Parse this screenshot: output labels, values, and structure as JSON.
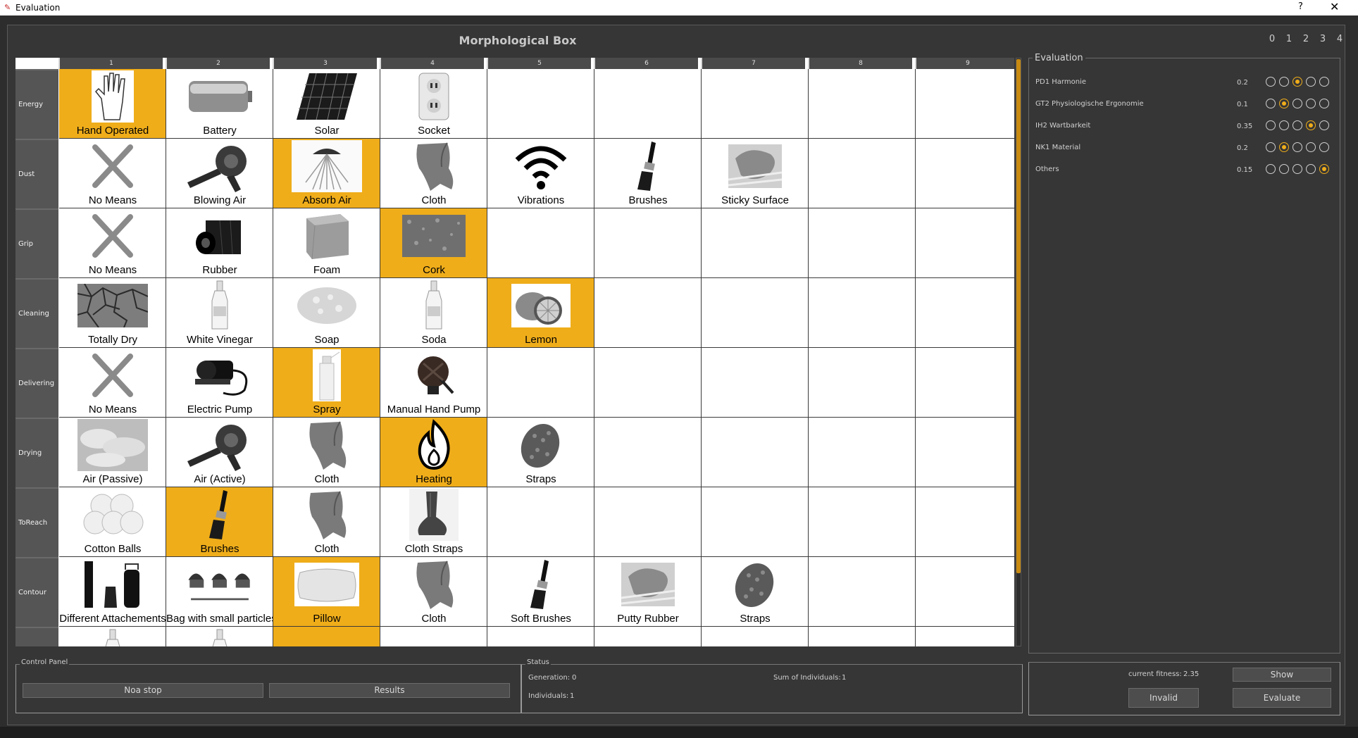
{
  "window": {
    "title": "Evaluation",
    "help": "?",
    "close": "✕"
  },
  "morph": {
    "title": "Morphological Box",
    "columns": [
      "1",
      "2",
      "3",
      "4",
      "5",
      "6",
      "7",
      "8",
      "9"
    ],
    "rows": [
      {
        "name": "Energy",
        "cells": [
          {
            "label": "Hand Operated",
            "icon": "hand",
            "sel": true
          },
          {
            "label": "Battery",
            "icon": "battery"
          },
          {
            "label": "Solar",
            "icon": "solar"
          },
          {
            "label": "Socket",
            "icon": "socket"
          },
          {},
          {},
          {},
          {},
          {}
        ]
      },
      {
        "name": "Dust",
        "cells": [
          {
            "label": "No Means",
            "icon": "x"
          },
          {
            "label": "Blowing   Air",
            "icon": "blower"
          },
          {
            "label": "Absorb    Air",
            "icon": "absorb",
            "sel": true
          },
          {
            "label": "Cloth",
            "icon": "cloth"
          },
          {
            "label": "Vibrations",
            "icon": "wifi"
          },
          {
            "label": "Brushes",
            "icon": "brush"
          },
          {
            "label": "Sticky Surface",
            "icon": "sticky"
          },
          {},
          {}
        ]
      },
      {
        "name": "Grip",
        "cells": [
          {
            "label": "No Means",
            "icon": "x"
          },
          {
            "label": "Rubber",
            "icon": "rubber"
          },
          {
            "label": "Foam",
            "icon": "foam"
          },
          {
            "label": "Cork",
            "icon": "cork",
            "sel": true
          },
          {},
          {},
          {},
          {},
          {}
        ]
      },
      {
        "name": "Cleaning",
        "cells": [
          {
            "label": "Totally    Dry",
            "icon": "dry"
          },
          {
            "label": "White Vinegar",
            "icon": "bottle"
          },
          {
            "label": "Soap",
            "icon": "soap"
          },
          {
            "label": "Soda",
            "icon": "bottle"
          },
          {
            "label": "Lemon",
            "icon": "lemon",
            "sel": true
          },
          {},
          {},
          {},
          {}
        ]
      },
      {
        "name": "Delivering",
        "cells": [
          {
            "label": "No Means",
            "icon": "x"
          },
          {
            "label": "Electric Pump",
            "icon": "pump"
          },
          {
            "label": "Spray",
            "icon": "spray",
            "sel": true
          },
          {
            "label": "Manual Hand Pump",
            "icon": "handpump"
          },
          {},
          {},
          {},
          {},
          {}
        ]
      },
      {
        "name": "Drying",
        "cells": [
          {
            "label": "Air  (Passive)",
            "icon": "clouds"
          },
          {
            "label": "Air     (Active)",
            "icon": "blower"
          },
          {
            "label": "Cloth",
            "icon": "cloth"
          },
          {
            "label": "Heating",
            "icon": "flame",
            "sel": true
          },
          {
            "label": "Straps",
            "icon": "straps"
          },
          {},
          {},
          {},
          {}
        ]
      },
      {
        "name": "ToReach",
        "cells": [
          {
            "label": "Cotton  Balls",
            "icon": "cotton"
          },
          {
            "label": "Brushes",
            "icon": "brush",
            "sel": true
          },
          {
            "label": "Cloth",
            "icon": "cloth"
          },
          {
            "label": "Cloth  Straps",
            "icon": "clothstraps"
          },
          {},
          {},
          {},
          {},
          {}
        ]
      },
      {
        "name": "Contour",
        "cells": [
          {
            "label": "Different Attachements",
            "icon": "attach"
          },
          {
            "label": "Bag with      small particles",
            "icon": "bag"
          },
          {
            "label": "Pillow",
            "icon": "pillow",
            "sel": true
          },
          {
            "label": "Cloth",
            "icon": "cloth"
          },
          {
            "label": "Soft  Brushes",
            "icon": "brush"
          },
          {
            "label": "Putty Rubber",
            "icon": "sticky"
          },
          {
            "label": "Straps",
            "icon": "straps"
          },
          {},
          {}
        ]
      },
      {
        "name": "",
        "cells": [
          {
            "label": "",
            "icon": "bottle"
          },
          {
            "label": "",
            "icon": "bottle"
          },
          {
            "label": "",
            "icon": "",
            "sel": true
          },
          {},
          {},
          {},
          {},
          {},
          {}
        ]
      }
    ]
  },
  "evaluation": {
    "legend": "Evaluation",
    "scale": [
      "0",
      "1",
      "2",
      "3",
      "4"
    ],
    "criteria": [
      {
        "name": "PD1 Harmonie",
        "weight": "0.2",
        "selected": 2
      },
      {
        "name": "GT2 Physiologische Ergonomie",
        "weight": "0.1",
        "selected": 1
      },
      {
        "name": "IH2 Wartbarkeit",
        "weight": "0.35",
        "selected": 3
      },
      {
        "name": "NK1 Material",
        "weight": "0.2",
        "selected": 1
      },
      {
        "name": "Others",
        "weight": "0.15",
        "selected": 4
      }
    ]
  },
  "control": {
    "legend": "Control Panel",
    "noa_stop": "Noa stop",
    "results": "Results"
  },
  "status": {
    "legend": "Status",
    "generation_label": "Generation:",
    "generation": "0",
    "individuals_label": "Individuals:",
    "individuals": "1",
    "sum_label": "Sum of Individuals:",
    "sum": "1"
  },
  "fitness": {
    "label": "current fitness:",
    "value": "2.35",
    "show": "Show",
    "invalid": "Invalid",
    "evaluate": "Evaluate"
  },
  "colors": {
    "accent": "#efad1a",
    "bg": "#363636"
  }
}
